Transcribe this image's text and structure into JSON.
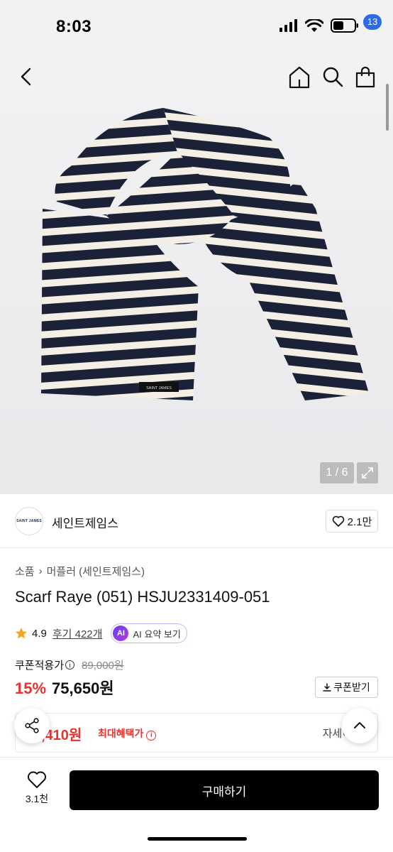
{
  "status_bar": {
    "time": "8:03"
  },
  "nav": {
    "cart_count": "13"
  },
  "gallery": {
    "counter": "1 / 6"
  },
  "brand": {
    "logo_text": "SAINT JAMES",
    "name": "세인트제임스",
    "likes": "2.1만"
  },
  "product": {
    "breadcrumb": [
      "소품",
      "머플러 (세인트제임스)"
    ],
    "title": "Scarf Raye (051) HSJU2331409-051",
    "label_text": "SAINT JAMES",
    "rating": "4.9",
    "reviews": "후기 422개",
    "ai_badge": "AI",
    "ai_summary": "AI 요약 보기"
  },
  "pricing": {
    "coupon_label": "쿠폰적용가",
    "original_price": "89,000원",
    "discount": "15%",
    "price": "75,650원",
    "coupon_button": "쿠폰받기",
    "benefit_price": ",410원",
    "benefit_label": "최대혜택가",
    "benefit_detail": "자세히"
  },
  "bottom": {
    "wish_count": "3.1천",
    "buy_label": "구매하기"
  },
  "colors": {
    "accent_red": "#e9332e",
    "badge_blue": "#2b6ce6",
    "scarf_navy": "#1b2238",
    "scarf_cream": "#f3efe4"
  }
}
